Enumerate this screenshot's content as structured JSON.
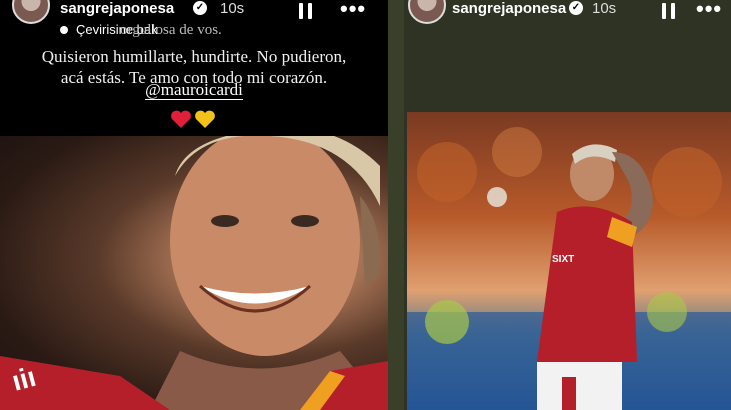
{
  "left_story": {
    "username": "sangrejaponesa",
    "time": "10s",
    "translate_label": "Çevirisine bak",
    "caption_line0": "orgullosa de vos.",
    "caption_line1": "Quisieron humillarte, hundirte. No pudieron,",
    "caption_line2": "acá estás. Te amo con todo mi corazón.",
    "mention": "@mauroicardi",
    "hearts": [
      "red-heart",
      "yellow-heart"
    ]
  },
  "right_story": {
    "username": "sangrejaponesa",
    "time": "10s"
  },
  "colors": {
    "left_bg": "#000000",
    "right_bg": "#2f3323",
    "jersey_red": "#b51f2a",
    "jersey_yellow": "#f0a020",
    "heart_red": "#e0203a",
    "heart_yellow": "#f2c21a"
  }
}
